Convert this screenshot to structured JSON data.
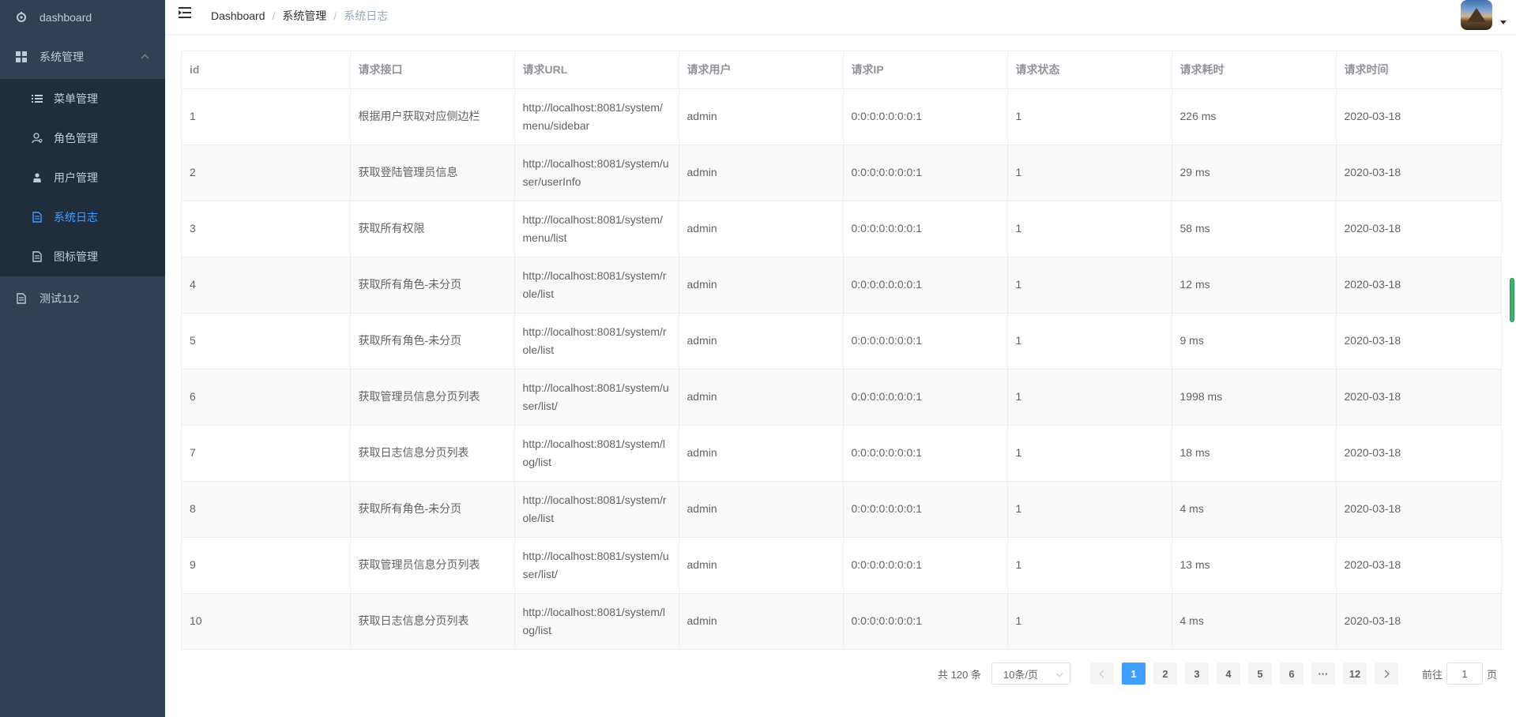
{
  "sidebar": {
    "items": [
      {
        "label": "dashboard",
        "icon": "dashboard-icon"
      },
      {
        "label": "系统管理",
        "icon": "grid-icon",
        "expanded": true
      },
      {
        "label": "菜单管理",
        "icon": "list-icon"
      },
      {
        "label": "角色管理",
        "icon": "user-role-icon"
      },
      {
        "label": "用户管理",
        "icon": "user-icon"
      },
      {
        "label": "系统日志",
        "icon": "document-icon",
        "active": true
      },
      {
        "label": "图标管理",
        "icon": "document-icon"
      },
      {
        "label": "测试112",
        "icon": "document-icon"
      }
    ],
    "active_color": "#409eff",
    "background": "#304156"
  },
  "navbar": {
    "breadcrumb": [
      "Dashboard",
      "系统管理",
      "系统日志"
    ],
    "separator": "/"
  },
  "table": {
    "columns": [
      "id",
      "请求接口",
      "请求URL",
      "请求用户",
      "请求IP",
      "请求状态",
      "请求耗时",
      "请求时间"
    ],
    "rows": [
      {
        "id": "1",
        "api": "根据用户获取对应侧边栏",
        "url": "http://localhost:8081/system/menu/sidebar",
        "user": "admin",
        "ip": "0:0:0:0:0:0:0:1",
        "status": "1",
        "cost": "226 ms",
        "time": "2020-03-18"
      },
      {
        "id": "2",
        "api": "获取登陆管理员信息",
        "url": "http://localhost:8081/system/user/userInfo",
        "user": "admin",
        "ip": "0:0:0:0:0:0:0:1",
        "status": "1",
        "cost": "29 ms",
        "time": "2020-03-18"
      },
      {
        "id": "3",
        "api": "获取所有权限",
        "url": "http://localhost:8081/system/menu/list",
        "user": "admin",
        "ip": "0:0:0:0:0:0:0:1",
        "status": "1",
        "cost": "58 ms",
        "time": "2020-03-18"
      },
      {
        "id": "4",
        "api": "获取所有角色-未分页",
        "url": "http://localhost:8081/system/role/list",
        "user": "admin",
        "ip": "0:0:0:0:0:0:0:1",
        "status": "1",
        "cost": "12 ms",
        "time": "2020-03-18"
      },
      {
        "id": "5",
        "api": "获取所有角色-未分页",
        "url": "http://localhost:8081/system/role/list",
        "user": "admin",
        "ip": "0:0:0:0:0:0:0:1",
        "status": "1",
        "cost": "9 ms",
        "time": "2020-03-18"
      },
      {
        "id": "6",
        "api": "获取管理员信息分页列表",
        "url": "http://localhost:8081/system/user/list/",
        "user": "admin",
        "ip": "0:0:0:0:0:0:0:1",
        "status": "1",
        "cost": "1998 ms",
        "time": "2020-03-18"
      },
      {
        "id": "7",
        "api": "获取日志信息分页列表",
        "url": "http://localhost:8081/system/log/list",
        "user": "admin",
        "ip": "0:0:0:0:0:0:0:1",
        "status": "1",
        "cost": "18 ms",
        "time": "2020-03-18"
      },
      {
        "id": "8",
        "api": "获取所有角色-未分页",
        "url": "http://localhost:8081/system/role/list",
        "user": "admin",
        "ip": "0:0:0:0:0:0:0:1",
        "status": "1",
        "cost": "4 ms",
        "time": "2020-03-18"
      },
      {
        "id": "9",
        "api": "获取管理员信息分页列表",
        "url": "http://localhost:8081/system/user/list/",
        "user": "admin",
        "ip": "0:0:0:0:0:0:0:1",
        "status": "1",
        "cost": "13 ms",
        "time": "2020-03-18"
      },
      {
        "id": "10",
        "api": "获取日志信息分页列表",
        "url": "http://localhost:8081/system/log/list",
        "user": "admin",
        "ip": "0:0:0:0:0:0:0:1",
        "status": "1",
        "cost": "4 ms",
        "time": "2020-03-18"
      }
    ]
  },
  "pagination": {
    "total_text": "共 120 条",
    "page_size": "10条/页",
    "pages": [
      "1",
      "2",
      "3",
      "4",
      "5",
      "6",
      "···",
      "12"
    ],
    "current_page": "1",
    "jump_prefix": "前往",
    "jump_value": "1",
    "jump_suffix": "页",
    "active_color": "#409eff"
  }
}
